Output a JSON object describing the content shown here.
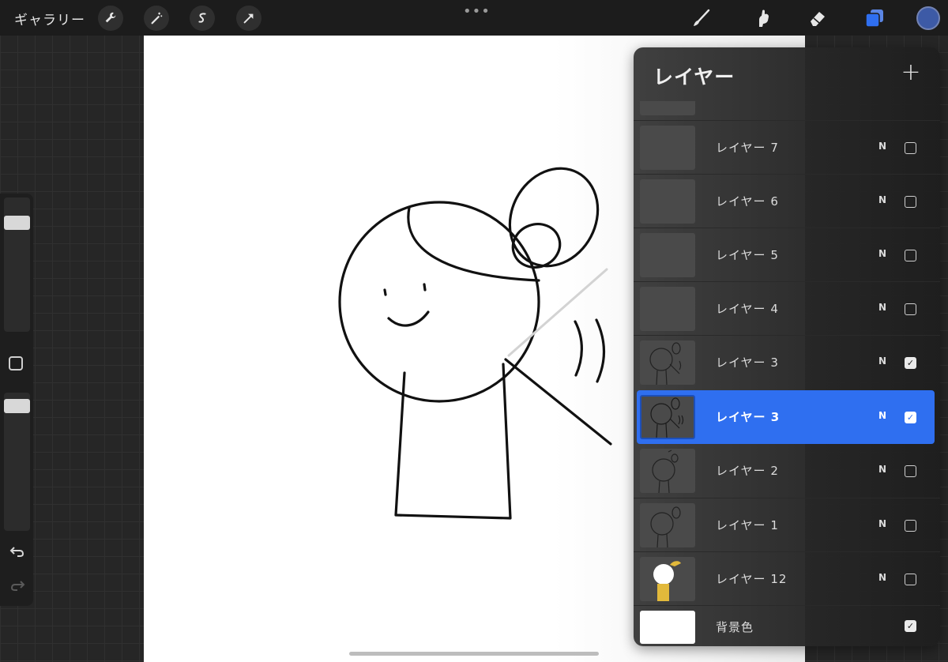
{
  "topbar": {
    "gallery_label": "ギャラリー",
    "left_tools": [
      "wrench-icon",
      "magic-wand-icon",
      "selection-icon",
      "transform-arrow-icon"
    ],
    "more_label": "•••",
    "right_tools": [
      "brush-icon",
      "smudge-icon",
      "eraser-icon",
      "layers-icon"
    ],
    "active_color": "#3d5aa6"
  },
  "sidebar": {
    "brush_size_level": 0.85,
    "opacity_level": 0.95
  },
  "panel": {
    "title": "レイヤー",
    "add_label": "+",
    "layers": [
      {
        "name": "レイヤー 7",
        "blend": "N",
        "visible": false
      },
      {
        "name": "レイヤー 6",
        "blend": "N",
        "visible": false
      },
      {
        "name": "レイヤー 5",
        "blend": "N",
        "visible": false
      },
      {
        "name": "レイヤー 4",
        "blend": "N",
        "visible": false
      },
      {
        "name": "レイヤー 3",
        "blend": "N",
        "visible": true
      },
      {
        "name": "レイヤー 3",
        "blend": "N",
        "visible": true,
        "selected": true
      },
      {
        "name": "レイヤー 2",
        "blend": "N",
        "visible": false
      },
      {
        "name": "レイヤー 1",
        "blend": "N",
        "visible": false
      },
      {
        "name": "レイヤー 12",
        "blend": "N",
        "visible": false
      }
    ],
    "background": {
      "name": "背景色",
      "visible": true
    }
  },
  "check_glyph": "✓",
  "colors": {
    "selection": "#2f6ff0",
    "toolbar_bg": "#1c1c1c",
    "canvas": "#ffffff"
  }
}
